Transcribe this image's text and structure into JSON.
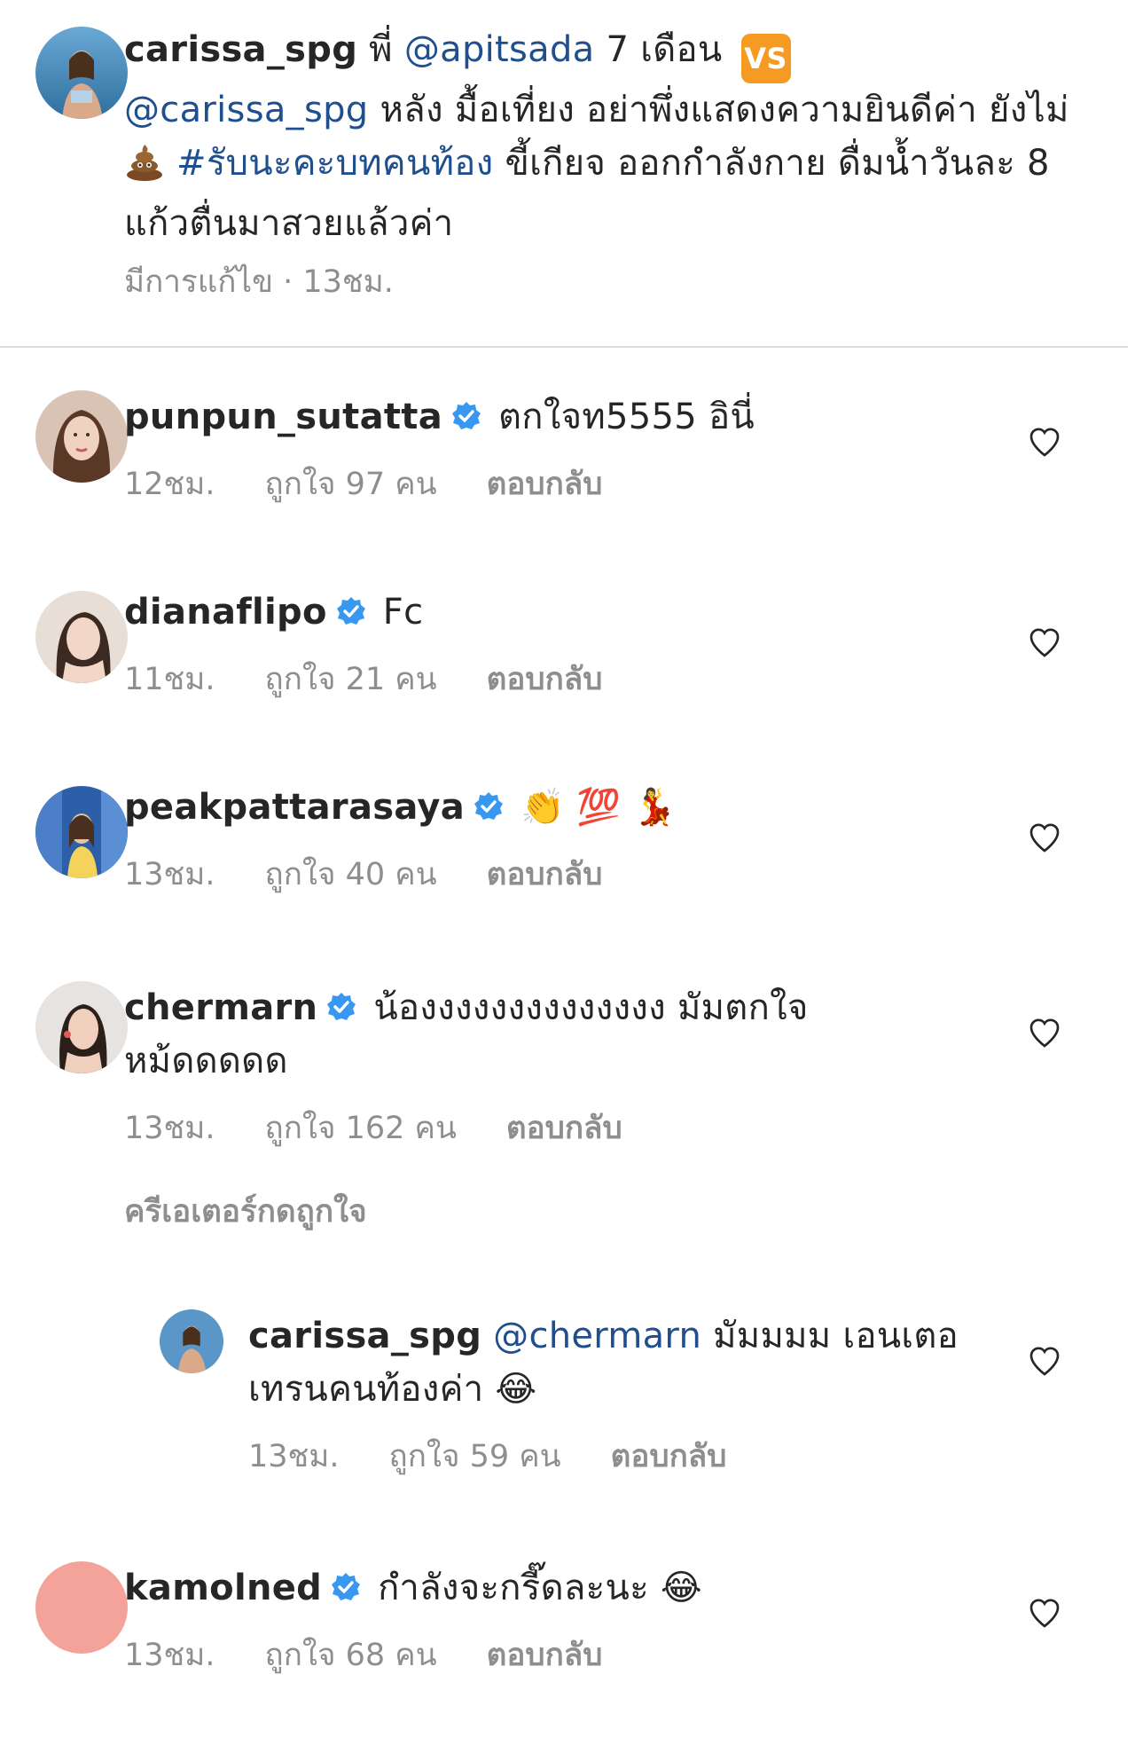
{
  "caption": {
    "username": "carissa_spg",
    "text_part1": " พี่ ",
    "mention1": "@apitsada",
    "text_part2": " 7 เดือน ",
    "vs_badge": "VS",
    "mention2": "@carissa_spg",
    "text_part3": " หลัง มื้อเที่ยง อย่าพึ่งแสดงความยินดีค่า ยังไม่ ",
    "poop_emoji": "💩",
    "hashtag": "#รับนะคะบทคนท้อง",
    "text_part4": " ขี้เกียจ ออกกำลังกาย ดื่มน้ำวันละ 8 แก้วตื่นมาสวยแล้วค่า",
    "meta": "มีการแก้ไข · 13ชม."
  },
  "comments": [
    {
      "username": "punpun_sutatta",
      "text": "ตกใจท5555 อินี่",
      "time": "12ชม.",
      "likes": "ถูกใจ 97 คน",
      "reply_label": "ตอบกลับ"
    },
    {
      "username": "dianaflipo",
      "text": "Fc",
      "time": "11ชม.",
      "likes": "ถูกใจ 21 คน",
      "reply_label": "ตอบกลับ"
    },
    {
      "username": "peakpattarasaya",
      "text": "👏 💯 💃",
      "time": "13ชม.",
      "likes": "ถูกใจ 40 คน",
      "reply_label": "ตอบกลับ"
    },
    {
      "username": "chermarn",
      "text": "น้องงงงงงงงงงงงงง มัมตกใจหม้ดดดดด",
      "time": "13ชม.",
      "likes": "ถูกใจ 162 คน",
      "reply_label": "ตอบกลับ",
      "creator_liked": "ครีเอเตอร์กดถูกใจ"
    },
    {
      "username": "kamolned",
      "text": "กำลังจะกรี๊ดละนะ 😂",
      "time": "13ชม.",
      "likes": "ถูกใจ 68 คน",
      "reply_label": "ตอบกลับ"
    }
  ],
  "reply": {
    "username": "carissa_spg",
    "mention": "@chermarn",
    "text": " มัมมมม เอนเตอเทรนคนท้องค่า 😂",
    "time": "13ชม.",
    "likes": "ถูกใจ 59 คน",
    "reply_label": "ตอบกลับ"
  },
  "colors": {
    "mention": "#1f4f8f",
    "verified": "#3897f0",
    "meta": "#8e8e8e",
    "placeholder_avatar": "#f4a39a"
  },
  "icons": [
    "heart-outline-icon",
    "verified-badge-icon"
  ]
}
